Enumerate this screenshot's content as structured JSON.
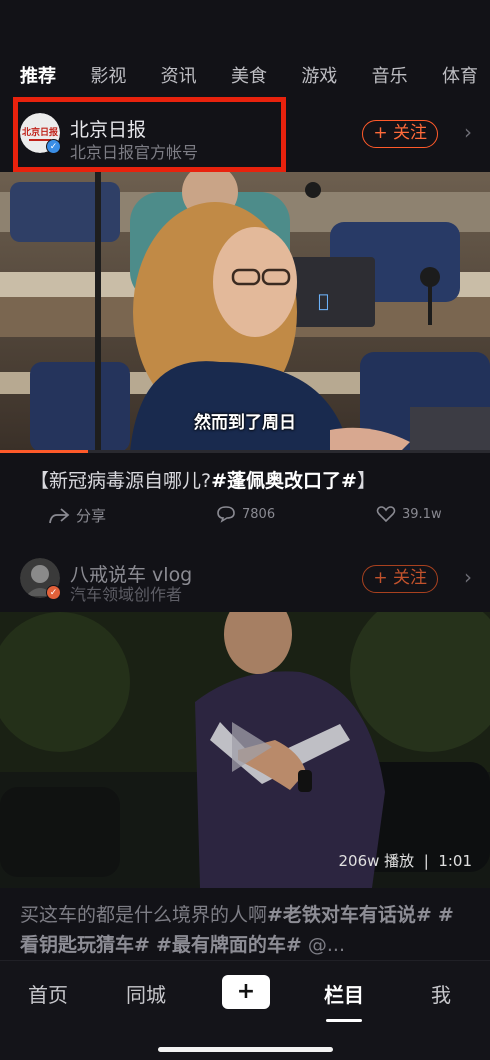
{
  "tabs": [
    "推荐",
    "影视",
    "资讯",
    "美食",
    "游戏",
    "音乐",
    "体育"
  ],
  "feed": [
    {
      "account_name": "北京日报",
      "account_sub": "北京日报官方帐号",
      "avatar_text": "北京日报",
      "follow_label": "+ 关注",
      "subtitle": "然而到了周日",
      "title_prefix": "【新冠病毒源自哪儿?",
      "title_hashtag": "#蓬佩奥改口了#",
      "title_suffix": "】",
      "share_label": "分享",
      "comments": "7806",
      "likes": "39.1w",
      "progress": 0.18
    },
    {
      "account_name": "八戒说车 vlog",
      "account_sub": "汽车领域创作者",
      "follow_label": "+ 关注",
      "views": "206w 播放",
      "duration": "1:01",
      "title_text_1": "买这车的都是什么境界的人啊",
      "title_tag_1": "#老铁对车有话说#",
      "title_tag_2": "#看钥匙玩猜车#",
      "title_tag_3": "#最有牌面的车#",
      "title_tail": "@..."
    }
  ],
  "bottom_nav": [
    "首页",
    "同城",
    "+",
    "栏目",
    "我"
  ],
  "colors": {
    "accent": "#ff5a2a",
    "highlight": "#e8220d",
    "background": "#121217"
  },
  "icons": [
    "verified-icon",
    "chevron-right-icon",
    "share-icon",
    "comment-icon",
    "heart-icon",
    "play-icon"
  ]
}
